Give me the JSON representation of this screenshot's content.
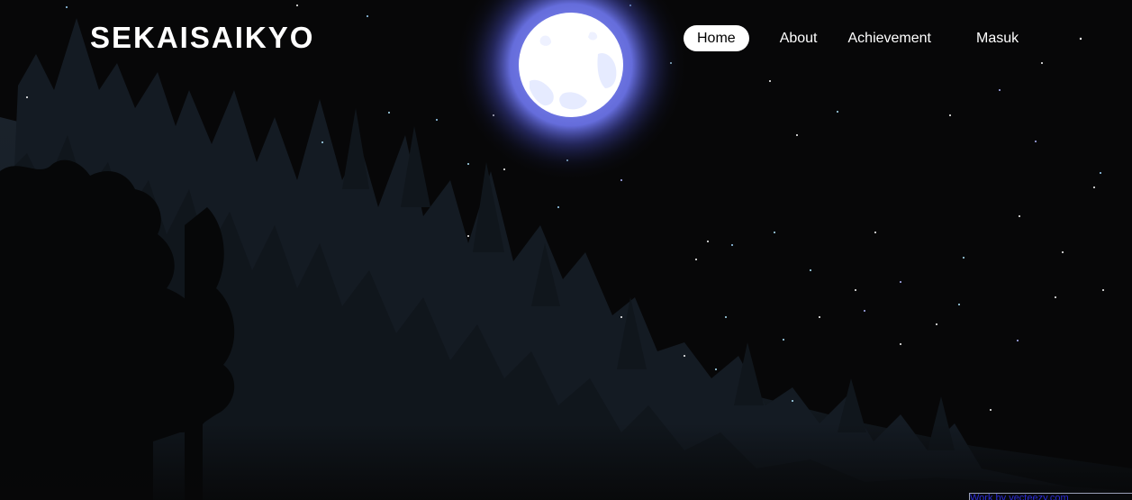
{
  "header": {
    "logo_text": "SEKAISAIKYO"
  },
  "nav": {
    "items": [
      {
        "label": "Home",
        "active": true
      },
      {
        "label": "About",
        "active": false
      },
      {
        "label": "Achievement",
        "active": false
      },
      {
        "label": "Masuk",
        "active": false
      }
    ]
  },
  "footer": {
    "credit_link_text": "Work by vecteezy.com"
  },
  "colors": {
    "background": "#070708",
    "text": "#ffffff",
    "active_pill": "#ffffff",
    "moon_glow": "#5a63d8",
    "forest_mist": "#1b232c"
  },
  "icons": {
    "moon": "full-moon",
    "stars": "stars",
    "forest": "pine-forest-silhouette"
  }
}
